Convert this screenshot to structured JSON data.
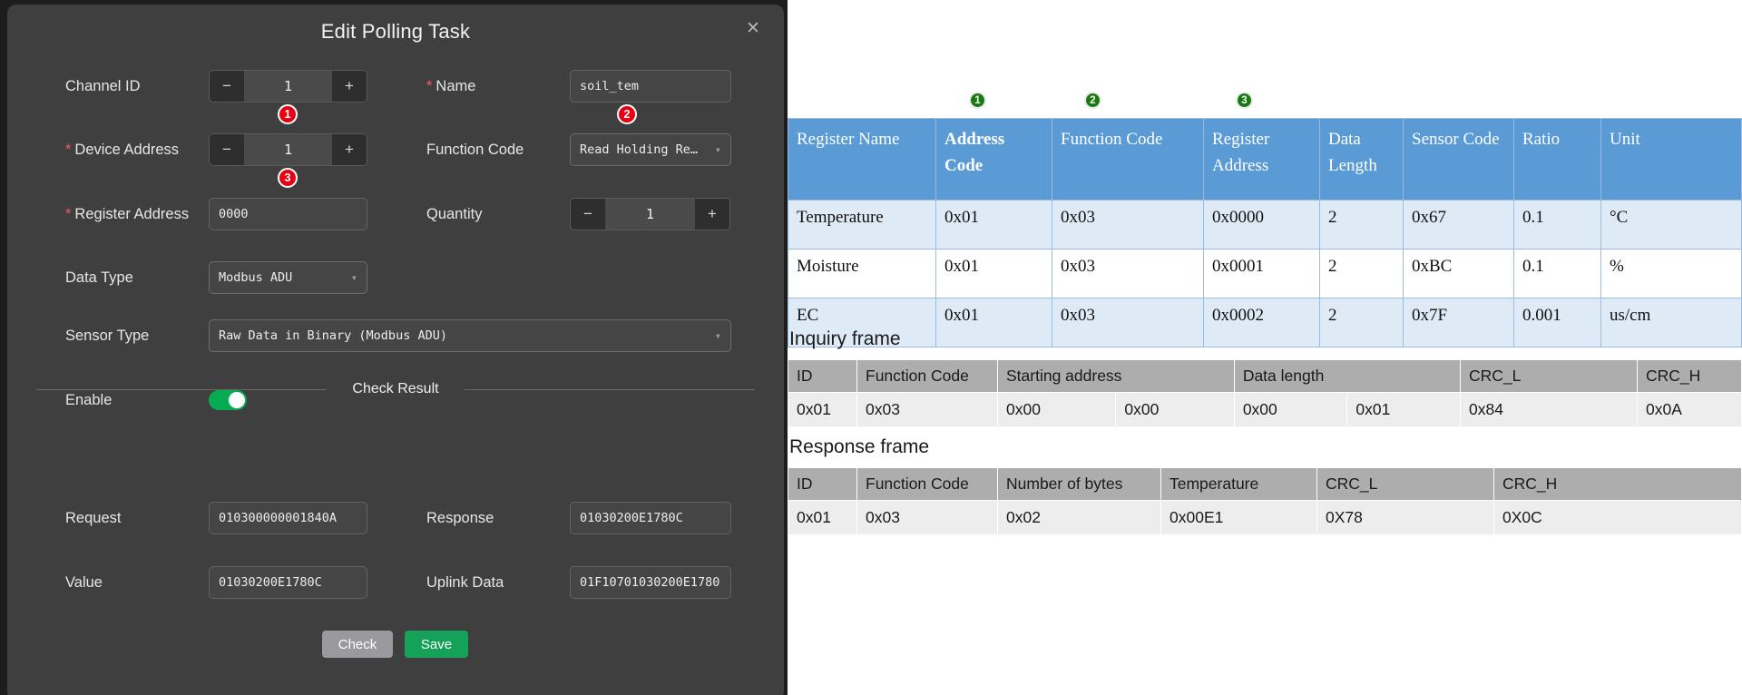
{
  "dialog": {
    "title": "Edit Polling Task",
    "close_icon": "close-icon",
    "fields": {
      "channel_id": {
        "label": "Channel ID",
        "value": "1",
        "minus": "−",
        "plus": "+"
      },
      "name": {
        "label": "Name",
        "required": "*",
        "value": "soil_tem"
      },
      "device_address": {
        "label": "Device Address",
        "required": "*",
        "value": "1",
        "minus": "−",
        "plus": "+"
      },
      "function_code": {
        "label": "Function Code",
        "value": "Read Holding Re…"
      },
      "register_address": {
        "label": "Register Address",
        "required": "*",
        "value": "0000"
      },
      "quantity": {
        "label": "Quantity",
        "value": "1",
        "minus": "−",
        "plus": "+"
      },
      "data_type": {
        "label": "Data Type",
        "value": "Modbus ADU"
      },
      "sensor_type": {
        "label": "Sensor Type",
        "value": "Raw Data in Binary (Modbus ADU)"
      },
      "enable": {
        "label": "Enable",
        "state": "on"
      }
    },
    "check_result": {
      "caption": "Check Result",
      "request": {
        "label": "Request",
        "value": "010300000001840A"
      },
      "response": {
        "label": "Response",
        "value": "01030200E1780C"
      },
      "value": {
        "label": "Value",
        "value": "01030200E1780C"
      },
      "uplink_data": {
        "label": "Uplink Data",
        "value": "01F10701030200E1780"
      }
    },
    "buttons": {
      "check": "Check",
      "save": "Save"
    },
    "annotations": [
      {
        "num": "1",
        "color": "#e60012"
      },
      {
        "num": "2",
        "color": "#e60012"
      },
      {
        "num": "3",
        "color": "#e60012"
      }
    ]
  },
  "doc": {
    "annotations": [
      {
        "num": "1",
        "color": "#1a7a12"
      },
      {
        "num": "2",
        "color": "#1a7a12"
      },
      {
        "num": "3",
        "color": "#1a7a12"
      }
    ],
    "register_table": {
      "headers": [
        "Register Name",
        "Address Code",
        "Function Code",
        "Register Address",
        "Data Length",
        "Sensor Code",
        "Ratio",
        "Unit"
      ],
      "rows": [
        [
          "Temperature",
          "0x01",
          "0x03",
          "0x0000",
          "2",
          "0x67",
          "0.1",
          "°C"
        ],
        [
          "Moisture",
          "0x01",
          "0x03",
          "0x0001",
          "2",
          "0xBC",
          "0.1",
          "%"
        ],
        [
          "EC",
          "0x01",
          "0x03",
          "0x0002",
          "2",
          "0x7F",
          "0.001",
          "us/cm"
        ]
      ]
    },
    "inquiry_frame": {
      "title": "Inquiry frame",
      "headers": [
        "ID",
        "Function Code",
        "Starting address",
        "Data length",
        "CRC_L",
        "CRC_H"
      ],
      "row": [
        "0x01",
        "0x03",
        "0x00",
        "0x00",
        "0x00",
        "0x01",
        "0x84",
        "0x0A"
      ]
    },
    "response_frame": {
      "title": "Response frame",
      "headers": [
        "ID",
        "Function Code",
        "Number of bytes",
        "Temperature",
        "CRC_L",
        "CRC_H"
      ],
      "row": [
        "0x01",
        "0x03",
        "0x02",
        "0x00E1",
        "0X78",
        "0X0C"
      ]
    }
  },
  "colors": {
    "dialog_bg": "#3f3f3f",
    "accent_green": "#13a257",
    "required_red": "#f05a5a",
    "table_header_blue": "#5b9bd5",
    "table_alt_row": "#deeaf6",
    "frame_header_gray": "#adadad"
  }
}
